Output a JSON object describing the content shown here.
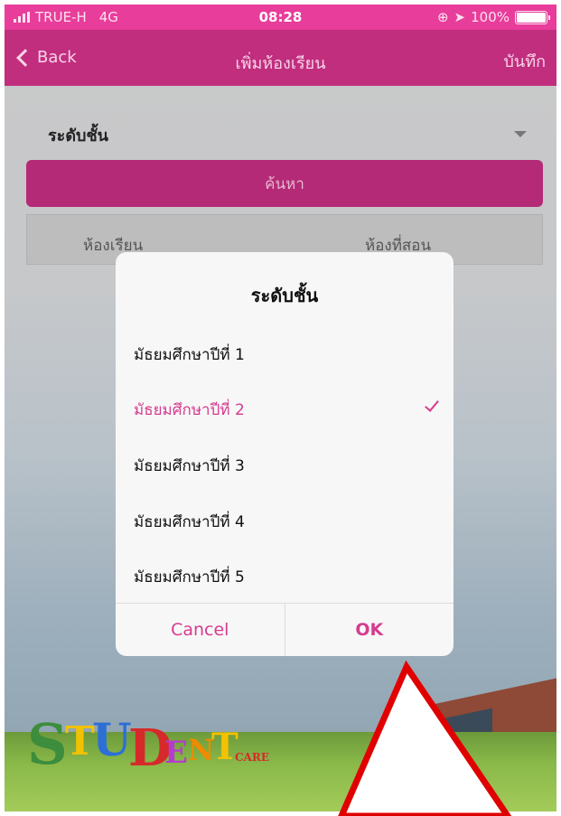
{
  "status_bar": {
    "carrier": "TRUE-H",
    "network": "4G",
    "time": "08:28",
    "battery": "100%",
    "battery_level": 1.0
  },
  "nav": {
    "back_label": "Back",
    "title": "เพิ่มห้องเรียน",
    "save_label": "บันทึก"
  },
  "form": {
    "level_label": "ระดับชั้น",
    "search_label": "ค้นหา",
    "tabs": [
      {
        "label": "ห้องเรียน"
      },
      {
        "label": "ห้องที่สอน"
      }
    ]
  },
  "dialog": {
    "title": "ระดับชั้น",
    "options": [
      {
        "label": "มัธยมศึกษาปีที่ 1",
        "selected": false
      },
      {
        "label": "มัธยมศึกษาปีที่ 2",
        "selected": true
      },
      {
        "label": "มัธยมศึกษาปีที่ 3",
        "selected": false
      },
      {
        "label": "มัธยมศึกษาปีที่ 4",
        "selected": false
      },
      {
        "label": "มัธยมศึกษาปีที่ 5",
        "selected": false
      }
    ],
    "cancel_label": "Cancel",
    "ok_label": "OK"
  },
  "logo": {
    "main": "STUDENT",
    "sub": "CARE"
  },
  "colors": {
    "accent": "#d63c8f",
    "nav": "#c12e7e",
    "status": "#e83d9a",
    "annotation": "#e00000"
  },
  "icons": {
    "back": "chevron-left-icon",
    "dropdown": "caret-down-icon",
    "selected": "checkmark-icon",
    "signal": "signal-bars-icon",
    "location": "location-arrow-icon",
    "battery": "battery-icon"
  }
}
